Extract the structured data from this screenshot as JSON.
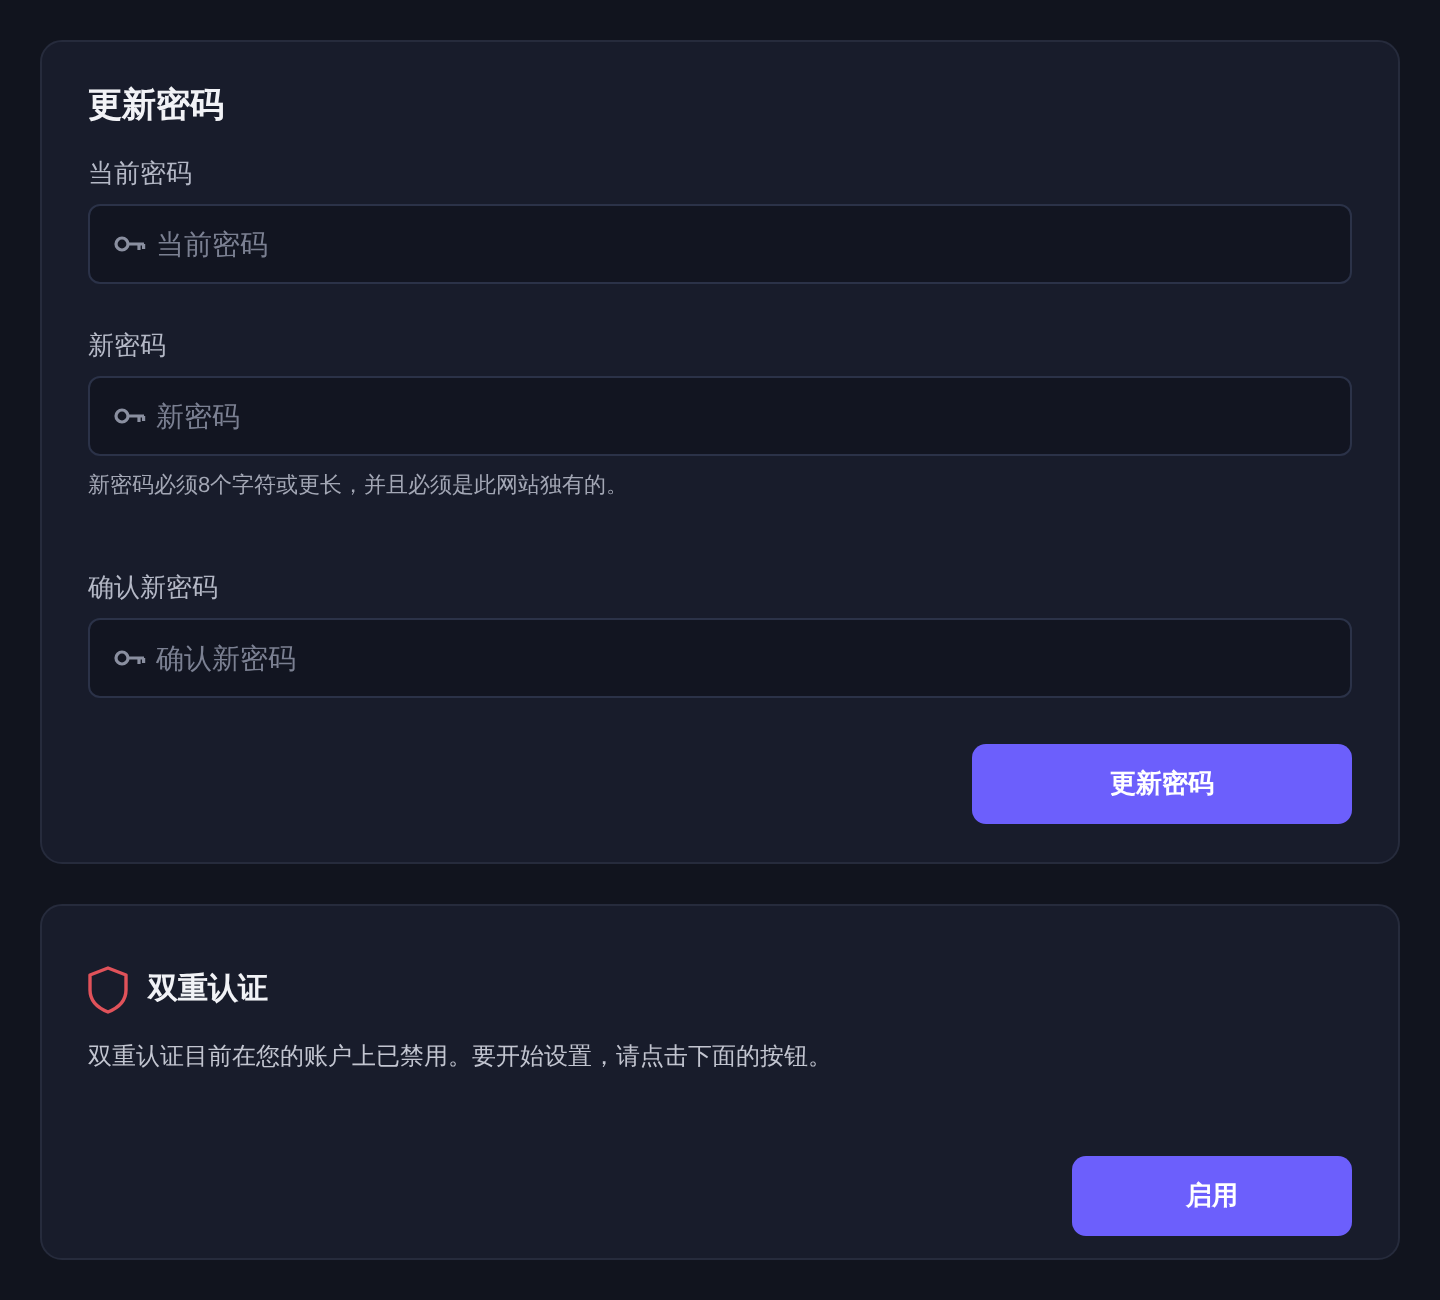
{
  "password_card": {
    "title": "更新密码",
    "fields": [
      {
        "label": "当前密码",
        "placeholder": "当前密码"
      },
      {
        "label": "新密码",
        "placeholder": "新密码",
        "help": "新密码必须8个字符或更长，并且必须是此网站独有的。"
      },
      {
        "label": "确认新密码",
        "placeholder": "确认新密码"
      }
    ],
    "button": "更新密码"
  },
  "two_factor_card": {
    "title": "双重认证",
    "text": "双重认证目前在您的账户上已禁用。要开始设置，请点击下面的按钮。",
    "button": "启用"
  }
}
